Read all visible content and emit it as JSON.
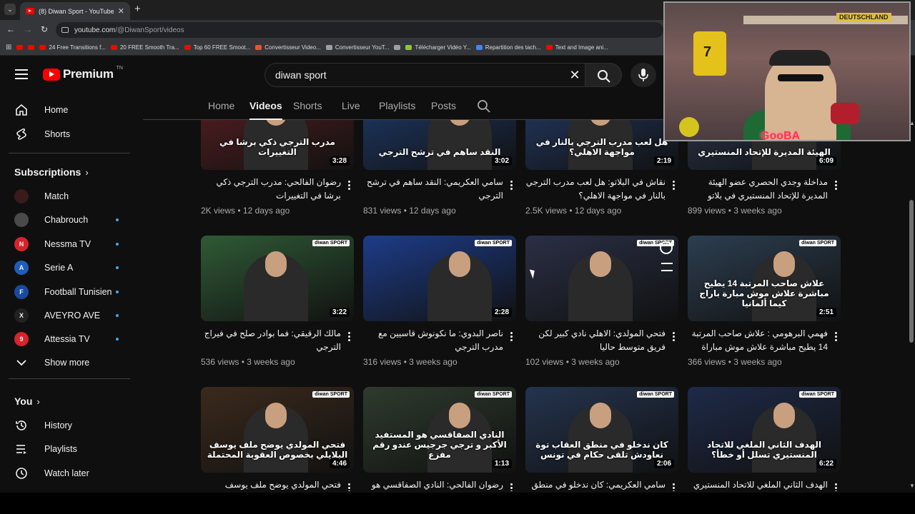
{
  "browser": {
    "tab_title": "(8) Diwan Sport - YouTube",
    "url": "youtube.com/@DiwanSport/videos",
    "url_host": "youtube.com",
    "url_path": "/@DiwanSport/videos",
    "bookmarks": [
      {
        "label": "",
        "color": "#ff0000"
      },
      {
        "label": "",
        "color": "#ff0000"
      },
      {
        "label": "24 Free Transitions f...",
        "color": "#ff0000"
      },
      {
        "label": "20 FREE Smooth Tra...",
        "color": "#ff0000"
      },
      {
        "label": "Top 60 FREE Smoot...",
        "color": "#ff0000"
      },
      {
        "label": "Convertisseur Video...",
        "color": "#e8542e"
      },
      {
        "label": "Convertisseur YouT...",
        "color": "#9aa0a6"
      },
      {
        "label": "",
        "color": "#9aa0a6"
      },
      {
        "label": "Télécharger Vidéo Y...",
        "color": "#8bc34a"
      },
      {
        "label": "Repartition des tach...",
        "color": "#4285f4"
      },
      {
        "label": "Text and Image ani...",
        "color": "#ff0000"
      }
    ]
  },
  "header": {
    "logo_text": "Premium",
    "country": "TN",
    "search_value": "diwan sport"
  },
  "sidebar": {
    "main": [
      {
        "label": "Home",
        "icon": "home-icon"
      },
      {
        "label": "Shorts",
        "icon": "shorts-icon"
      }
    ],
    "subscriptions_title": "Subscriptions",
    "subscriptions": [
      {
        "label": "Match",
        "color": "#3a1a1a",
        "initial": "",
        "dot": false
      },
      {
        "label": "Chabrouch",
        "color": "#4a4a4a",
        "initial": "",
        "dot": true
      },
      {
        "label": "Nessma TV",
        "color": "#d8232a",
        "initial": "N",
        "dot": true
      },
      {
        "label": "Serie A",
        "color": "#1e5dbc",
        "initial": "A",
        "dot": true
      },
      {
        "label": "Football Tunisien",
        "color": "#1a4a9e",
        "initial": "F",
        "dot": true
      },
      {
        "label": "AVEYRO AVE",
        "color": "#222222",
        "initial": "X",
        "dot": true
      },
      {
        "label": "Attessia TV",
        "color": "#d8232a",
        "initial": "9",
        "dot": true
      }
    ],
    "show_more": "Show more",
    "you_title": "You",
    "you_items": [
      {
        "label": "History",
        "icon": "history-icon"
      },
      {
        "label": "Playlists",
        "icon": "playlists-icon"
      },
      {
        "label": "Watch later",
        "icon": "watch-later-icon"
      }
    ]
  },
  "channel_tabs": [
    "Home",
    "Videos",
    "Shorts",
    "Live",
    "Playlists",
    "Posts"
  ],
  "active_tab": "Videos",
  "videos": [
    {
      "title": "رضوان الفالحي: مدرب الترجي ذكي برشا في التغييرات",
      "views": "2K views",
      "age": "12 days ago",
      "duration": "3:28",
      "overlay": "مدرب الترجي ذكي برشا في التغييرات",
      "bg": "#5a1f22"
    },
    {
      "title": "سامي العكريمي: النقد ساهم في ترشح الترجي",
      "views": "831 views",
      "age": "12 days ago",
      "duration": "3:02",
      "overlay": "النقد ساهم في ترشح الترجي",
      "bg": "#1f3c6e"
    },
    {
      "title": "نقاش في البلاتو: هل لعب مدرب الترجي بالنار في مواجهة الاهلي؟",
      "views": "2.5K views",
      "age": "12 days ago",
      "duration": "2:19",
      "overlay": "هل لعب مدرب الترجي بالنار في مواجهة الاهلي؟",
      "bg": "#233b66"
    },
    {
      "title": "مداخلة وجدي الحصري عضو الهيئة المديرة للإتحاد المنستيري في بلاتو TFOOT",
      "views": "899 views",
      "age": "3 weeks ago",
      "duration": "6:09",
      "overlay": "الهيئة المديرة للإتحاد المنستيري",
      "bg": "#2d3a55"
    },
    {
      "title": "مالك الرقيقي: فما بوادر صلح في فيراج الترجي",
      "views": "536 views",
      "age": "3 weeks ago",
      "duration": "3:22",
      "overlay": "",
      "bg": "#2f5a36"
    },
    {
      "title": "ناصر البدوي: ما نكونوش قاسيين مع مدرب الترجي",
      "views": "316 views",
      "age": "3 weeks ago",
      "duration": "2:28",
      "overlay": "",
      "bg": "#1d3c8a"
    },
    {
      "title": "فتحي المولدي: الاهلي نادي كبير لكن فريق متوسط حاليا",
      "views": "102 views",
      "age": "3 weeks ago",
      "duration": "",
      "overlay": "",
      "bg": "#2a2f45"
    },
    {
      "title": "فهمي البرهومي : علاش صاحب المرتبة 14 يطيح مباشرة علاش موش مباراة بارجا كيما المانيا ...",
      "views": "366 views",
      "age": "3 weeks ago",
      "duration": "2:51",
      "overlay": "علاش صاحب المرتبة 14 يطيح مباشرة علاش موش مبارة باراج كيما ألمانيا",
      "bg": "#2c3e50"
    },
    {
      "title": "فتحي المولدي يوضح ملف يوسف البلايلي",
      "views": "",
      "age": "",
      "duration": "4:46",
      "overlay": "فتحي المولدي يوضح ملف يوسف البلايلي بخصوص العقوبة المحتملة",
      "bg": "#3b2a1c"
    },
    {
      "title": "رضوان الفالحي: النادي الصفاقسي هو",
      "views": "",
      "age": "",
      "duration": "1:13",
      "overlay": "النادي الصفاقسي هو المستفيد الأكبر و ترجي جرجيس عندو رقم مفزع",
      "bg": "#2e3b2e"
    },
    {
      "title": "سامي العكريمي: كان ندخلو في منطق العقاب",
      "views": "",
      "age": "",
      "duration": "2:06",
      "overlay": "كان ندخلو في منطق العقاب توة نعاودش تلقى حكام في تونس",
      "bg": "#24344f"
    },
    {
      "title": "الهدف الثاني الملغي للاتحاد المنستيري تسلل",
      "views": "",
      "age": "",
      "duration": "6:22",
      "overlay": "الهدف الثاني الملغي للاتحاد المنستيري تسلل أو خطأ؟",
      "bg": "#1e2a48"
    }
  ],
  "thumb_tags": {
    "brand": "diwan SPORT",
    "show": "TFOOT"
  },
  "webcam": {
    "jersey_number": "7",
    "shelf_label": "DEUTSCHLAND",
    "overlay_brand": "GooBA"
  }
}
